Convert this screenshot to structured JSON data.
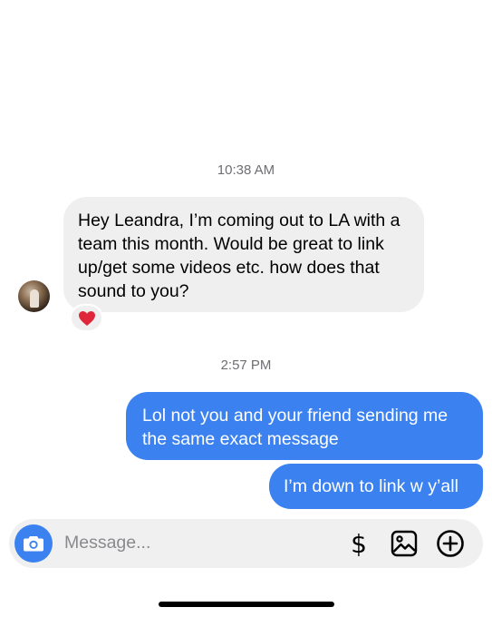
{
  "conversation": {
    "timestamps": [
      "10:38 AM",
      "2:57 PM"
    ],
    "messages": [
      {
        "direction": "incoming",
        "text": "Hey Leandra, I’m coming out to LA with a team this month. Would be great to link up/get some videos etc. how does that sound to you?",
        "reaction": "❤️"
      },
      {
        "direction": "outgoing",
        "text": "Lol not you and your friend sending me the same exact message"
      },
      {
        "direction": "outgoing",
        "text": "I’m down to link w y’all"
      }
    ]
  },
  "composer": {
    "placeholder": "Message...",
    "dollar_label": "$",
    "icons": [
      "camera-icon",
      "dollar-icon",
      "gallery-icon",
      "plus-circle-icon"
    ]
  },
  "colors": {
    "accent": "#3b82f0",
    "incoming_bubble": "#efefef",
    "composer_bg": "#f0f0f0",
    "timestamp": "#6e6e73",
    "reaction_heart": "#e0263a"
  }
}
